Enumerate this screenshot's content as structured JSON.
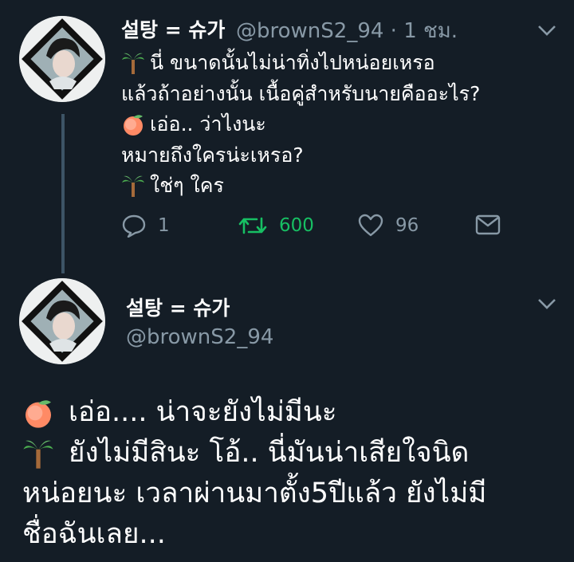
{
  "tweet1": {
    "name": "설탕 = 슈가",
    "handle": "@brownS2_94 · 1 ชม.",
    "lines": [
      {
        "emoji": "palm-tree",
        "text": "นี่ ขนาดนั้นไม่น่าทิ่งไปหน่อยเหรอ"
      },
      {
        "emoji": "",
        "text": "แล้วถ้าอย่างนั้น เนื้อคู่สำหรับนายคืออะไร?"
      },
      {
        "emoji": "peach",
        "text": "เอ่อ.. ว่าไงนะ"
      },
      {
        "emoji": "",
        "text": "หมายถึงใครน่ะเหรอ?"
      },
      {
        "emoji": "palm-tree",
        "text": "ใช่ๆ ใคร"
      }
    ],
    "actions": {
      "replies": "1",
      "retweets": "600",
      "likes": "96"
    }
  },
  "tweet2": {
    "name": "설탕 = 슈가",
    "handle": "@brownS2_94",
    "lines": [
      {
        "emoji": "peach",
        "text": "เอ่อ.... น่าจะยังไม่มีนะ"
      },
      {
        "emoji": "palm-tree",
        "text": "ยังไม่มีสินะ โอ้.. นี่มันน่าเสียใจนิด"
      },
      {
        "emoji": "",
        "text": "หน่อยนะ เวลาผ่านมาตั้ง5ปีแล้ว ยังไม่มี"
      },
      {
        "emoji": "",
        "text": "ชื่อฉันเลย..."
      }
    ]
  },
  "colors": {
    "background": "#141d26",
    "muted": "#8899a6",
    "retweet": "#17bf63",
    "thread_line": "#3d5466"
  }
}
